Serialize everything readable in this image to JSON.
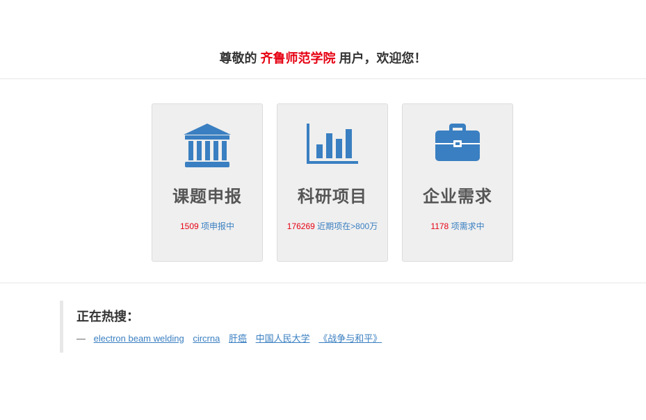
{
  "welcome": {
    "prefix": "尊敬的",
    "org": "齐鲁师范学院",
    "suffix": "用户，欢迎您！"
  },
  "cards": [
    {
      "title": "课题申报",
      "count": "1509",
      "text": "项申报中",
      "icon": "institution-icon"
    },
    {
      "title": "科研项目",
      "count": "176269",
      "text": "近期项在>800万",
      "icon": "bar-chart-icon"
    },
    {
      "title": "企业需求",
      "count": "1178",
      "text": "项需求中",
      "icon": "briefcase-icon"
    }
  ],
  "hot_search": {
    "label": "正在热搜：",
    "dash": "—",
    "links": [
      "electron beam welding",
      "circrna",
      "肝癌",
      "中国人民大学",
      "《战争与和平》"
    ]
  },
  "colors": {
    "accent_blue": "#3a7fc1",
    "highlight_red": "#e60012",
    "card_bg": "#efefef"
  }
}
